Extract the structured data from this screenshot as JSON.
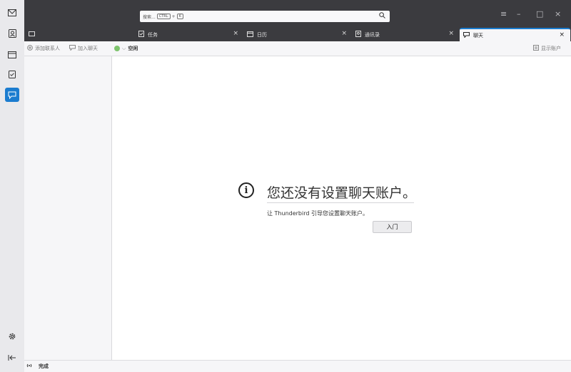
{
  "window": {
    "search_placeholder": "搜索...",
    "search_shortcut_mod": "CTRL",
    "search_shortcut_plus": "+",
    "search_shortcut_key": "K",
    "controls": {
      "menu": "≡",
      "minimize": "–",
      "maximize": "□",
      "close": "×"
    }
  },
  "spaces": [
    {
      "icon": "mail-icon",
      "active": false
    },
    {
      "icon": "address-book-icon",
      "active": false
    },
    {
      "icon": "calendar-icon",
      "active": false
    },
    {
      "icon": "tasks-icon",
      "active": false
    },
    {
      "icon": "chat-icon",
      "active": true
    }
  ],
  "spaces_bottom": {
    "settings_icon": "gear-icon",
    "collapse_icon": "collapse-left-icon"
  },
  "tabs": [
    {
      "label": "",
      "icon": "mail-icon",
      "selected": false
    },
    {
      "label": "任务",
      "icon": "tasks-icon",
      "selected": false
    },
    {
      "label": "日历",
      "icon": "calendar-icon",
      "selected": false
    },
    {
      "label": "通讯录",
      "icon": "address-book-icon",
      "selected": false
    },
    {
      "label": "聊天",
      "icon": "chat-icon",
      "selected": true
    }
  ],
  "toolbar": {
    "add_contact": "添加联系人",
    "join_chat": "加入聊天",
    "status": "空闲",
    "status_color": "#7ec46d",
    "show_accounts": "显示账户"
  },
  "main": {
    "heading": "您还没有设置聊天账户。",
    "description": "让 Thunderbird 引导您设置聊天账户。",
    "start_button": "入门"
  },
  "statusbar": {
    "text": "完成"
  },
  "colors": {
    "accent": "#1b7ccf",
    "titlebar": "#3b3b3f"
  }
}
